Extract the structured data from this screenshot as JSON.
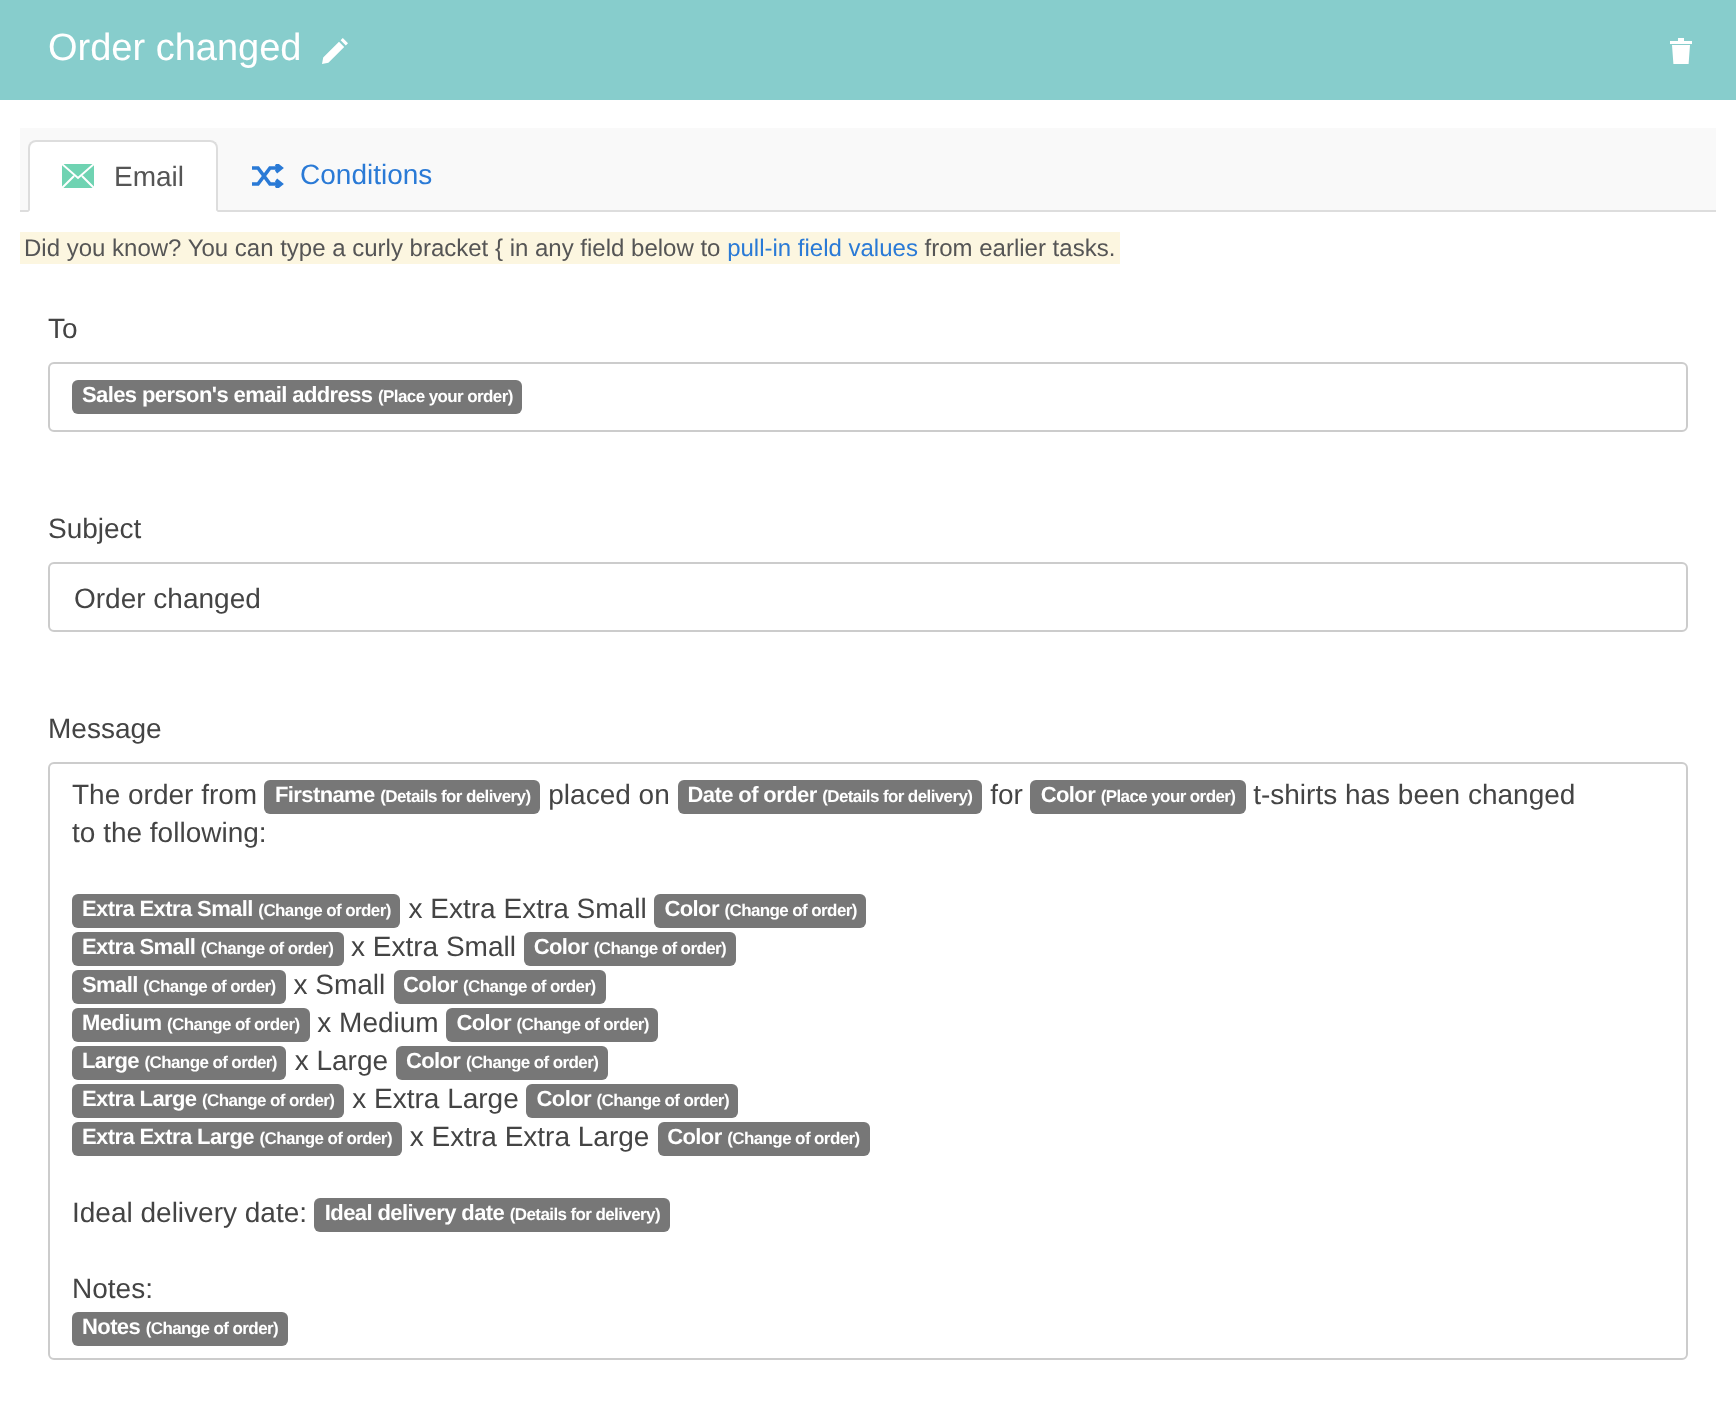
{
  "header": {
    "title": "Order changed"
  },
  "tabs": [
    {
      "label": "Email",
      "kind": "email",
      "selected": true
    },
    {
      "label": "Conditions",
      "kind": "conditions",
      "selected": false
    }
  ],
  "tip": {
    "before": "Did you know? You can type a curly bracket { in any field below to",
    "link": "pull-in field values",
    "after": "from earlier tasks."
  },
  "to": {
    "label": "To",
    "tokens": [
      {
        "label": "Sales person's email address",
        "source": "(Place your order)"
      }
    ]
  },
  "subject": {
    "label": "Subject",
    "value": "Order changed"
  },
  "message": {
    "label": "Message",
    "blocks": [
      {
        "lines": [
          [
            {
              "kind": "text",
              "text": "The order from"
            },
            {
              "kind": "token",
              "label": "Firstname",
              "source": "(Details for delivery)"
            },
            {
              "kind": "text",
              "text": "placed on"
            },
            {
              "kind": "token",
              "label": "Date of order",
              "source": "(Details for delivery)"
            },
            {
              "kind": "text",
              "text": "for"
            },
            {
              "kind": "token",
              "label": "Color",
              "source": "(Place your order)"
            },
            {
              "kind": "text",
              "text": "t-shirts has been changed"
            },
            {
              "kind": "text",
              "text": "to the following:"
            }
          ]
        ]
      },
      {
        "lines": [
          [
            {
              "kind": "token",
              "label": "Extra Extra Small",
              "source": "(Change of order)"
            },
            {
              "kind": "text",
              "text": "x Extra Extra Small"
            },
            {
              "kind": "token",
              "label": "Color",
              "source": "(Change of order)"
            }
          ],
          [
            {
              "kind": "token",
              "label": "Extra Small",
              "source": "(Change of order)"
            },
            {
              "kind": "text",
              "text": "x Extra Small"
            },
            {
              "kind": "token",
              "label": "Color",
              "source": "(Change of order)"
            }
          ],
          [
            {
              "kind": "token",
              "label": "Small",
              "source": "(Change of order)"
            },
            {
              "kind": "text",
              "text": "x Small"
            },
            {
              "kind": "token",
              "label": "Color",
              "source": "(Change of order)"
            }
          ],
          [
            {
              "kind": "token",
              "label": "Medium",
              "source": "(Change of order)"
            },
            {
              "kind": "text",
              "text": "x Medium"
            },
            {
              "kind": "token",
              "label": "Color",
              "source": "(Change of order)"
            }
          ],
          [
            {
              "kind": "token",
              "label": "Large",
              "source": "(Change of order)"
            },
            {
              "kind": "text",
              "text": "x Large"
            },
            {
              "kind": "token",
              "label": "Color",
              "source": "(Change of order)"
            }
          ],
          [
            {
              "kind": "token",
              "label": "Extra Large",
              "source": "(Change of order)"
            },
            {
              "kind": "text",
              "text": "x Extra Large"
            },
            {
              "kind": "token",
              "label": "Color",
              "source": "(Change of order)"
            }
          ],
          [
            {
              "kind": "token",
              "label": "Extra Extra Large",
              "source": "(Change of order)"
            },
            {
              "kind": "text",
              "text": "x Extra Extra Large"
            },
            {
              "kind": "token",
              "label": "Color",
              "source": "(Change of order)"
            }
          ]
        ]
      },
      {
        "lines": [
          [
            {
              "kind": "text",
              "text": "Ideal delivery date:"
            },
            {
              "kind": "token",
              "label": "Ideal delivery date",
              "source": "(Details for delivery)"
            }
          ]
        ]
      },
      {
        "lines": [
          [
            {
              "kind": "text",
              "text": "Notes:"
            }
          ],
          [
            {
              "kind": "token",
              "label": "Notes",
              "source": "(Change of order)"
            }
          ]
        ]
      }
    ]
  }
}
